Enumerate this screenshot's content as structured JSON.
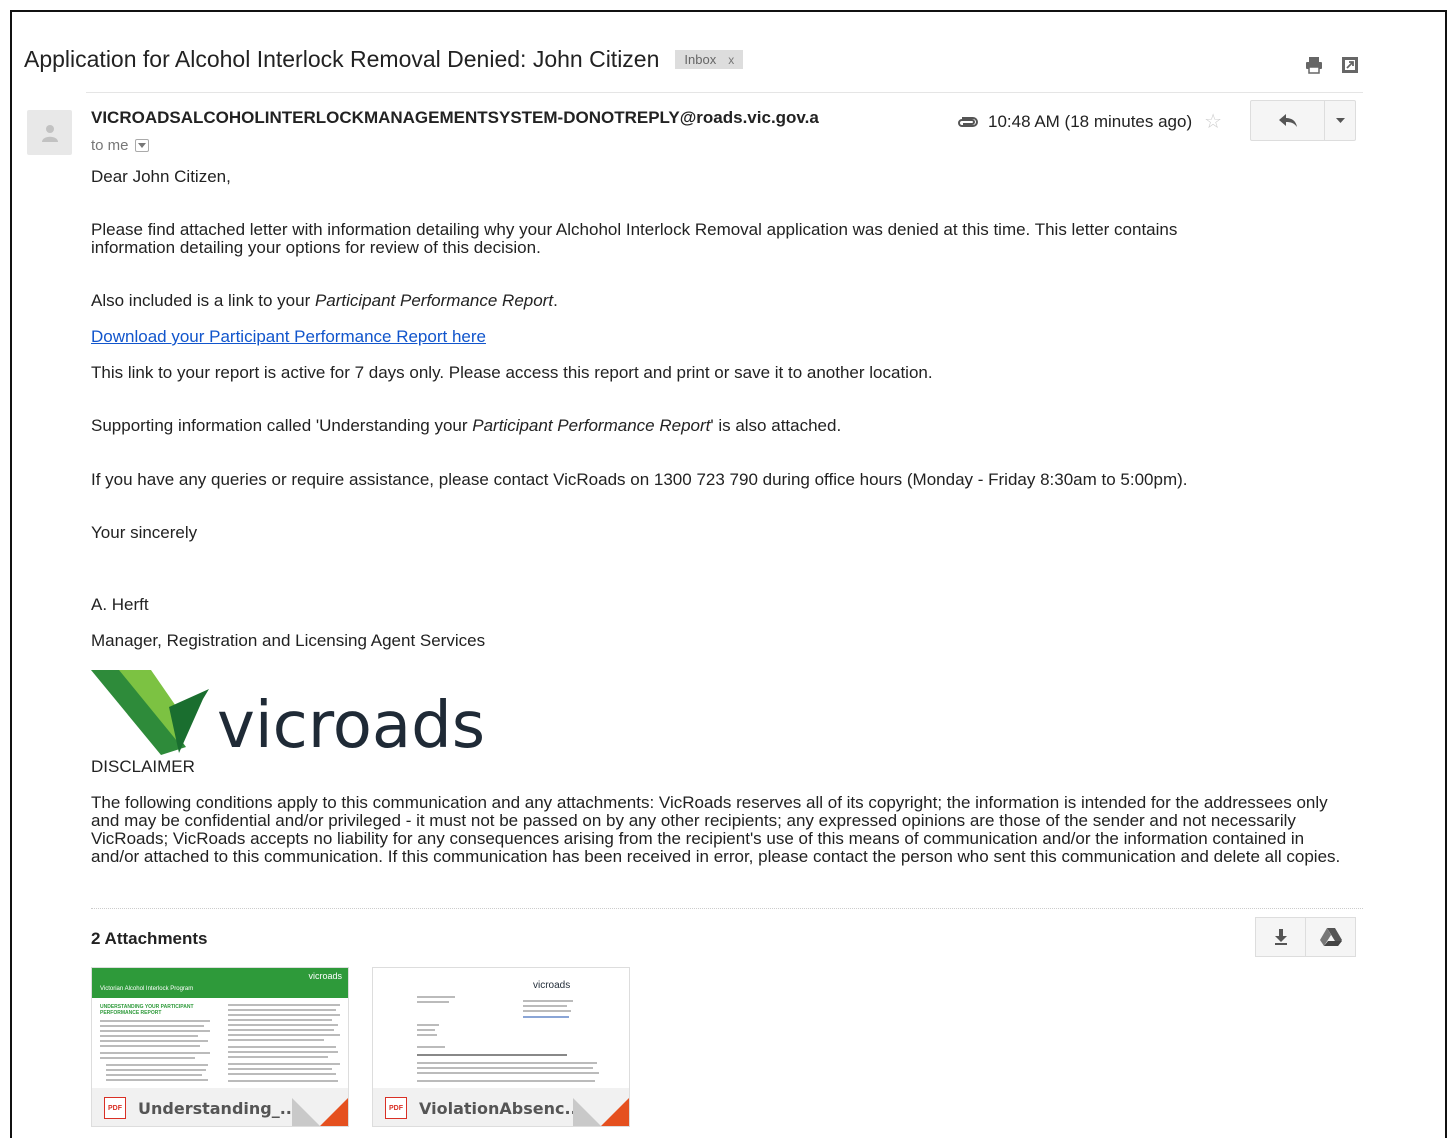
{
  "header": {
    "subject": "Application for Alcohol Interlock Removal Denied: John Citizen",
    "label": "Inbox",
    "label_close": "x",
    "print_icon": "print-icon",
    "newwindow_icon": "new-window-icon"
  },
  "message": {
    "sender": "VICROADSALCOHOLINTERLOCKMANAGEMENTSYSTEM-DONOTREPLY@roads.vic.gov.a",
    "to": "to me",
    "time": "10:48 AM (18 minutes ago)",
    "attachment_icon": "paperclip-icon",
    "star_icon": "star-icon",
    "reply_icon": "reply-icon",
    "more_icon": "chevron-down-icon"
  },
  "body": {
    "greeting": "Dear John Citizen,",
    "para1_line1": "Please find attached letter with information detailing why your Alchohol Interlock Removal application was denied at this time. This letter contains",
    "para1_line2": "information detailing your options for review of this decision.",
    "para2_prefix": "Also included is a link to your ",
    "para2_italic": "Participant Performance Report",
    "para2_suffix": ".",
    "link_text": "Download your Participant Performance Report here",
    "para3": "This link to your report is active for 7 days only. Please access this report and print or save it to another location.",
    "para4_prefix": "Supporting information called 'Understanding your ",
    "para4_italic": "Participant Performance Report",
    "para4_suffix": "' is also attached.",
    "para5": "If you have any queries or require assistance, please contact VicRoads on 1300 723 790 during office hours (Monday - Friday 8:30am to 5:00pm).",
    "closing": "Your sincerely",
    "signature_name": "A. Herft",
    "signature_title": "Manager, Registration and Licensing Agent Services",
    "logo_text": "vicroads",
    "disclaimer_title": "DISCLAIMER",
    "disclaimer_text": "The following conditions apply to this communication and any attachments: VicRoads reserves all of its copyright; the information is intended for the addressees only and may be confidential and/or privileged - it must not be passed on by any other recipients; any expressed opinions are those of the sender and not necessarily VicRoads; VicRoads accepts no liability for any consequences arising from the recipient's use of this means of communication and/or the information contained in and/or attached to this communication. If this communication has been received in error, please contact the person who sent this communication and delete all copies."
  },
  "attachments": {
    "title": "2 Attachments",
    "download_icon": "download-icon",
    "drive_icon": "drive-icon",
    "items": [
      {
        "name": "Understanding_...",
        "type": "PDF",
        "thumb_logo": "vicroads",
        "thumb_banner": "Victorian Alcohol Interlock Program",
        "thumb_heading": "UNDERSTANDING YOUR PARTICIPANT PERFORMANCE REPORT"
      },
      {
        "name": "ViolationAbsenc...",
        "type": "PDF",
        "thumb_logo": "vicroads"
      }
    ]
  },
  "colors": {
    "link": "#1155cc",
    "vicroads_green": "#2e8b3a",
    "vicroads_dark": "#1f2a36",
    "pdf_red": "#d93025",
    "corner_orange": "#e5501f"
  }
}
